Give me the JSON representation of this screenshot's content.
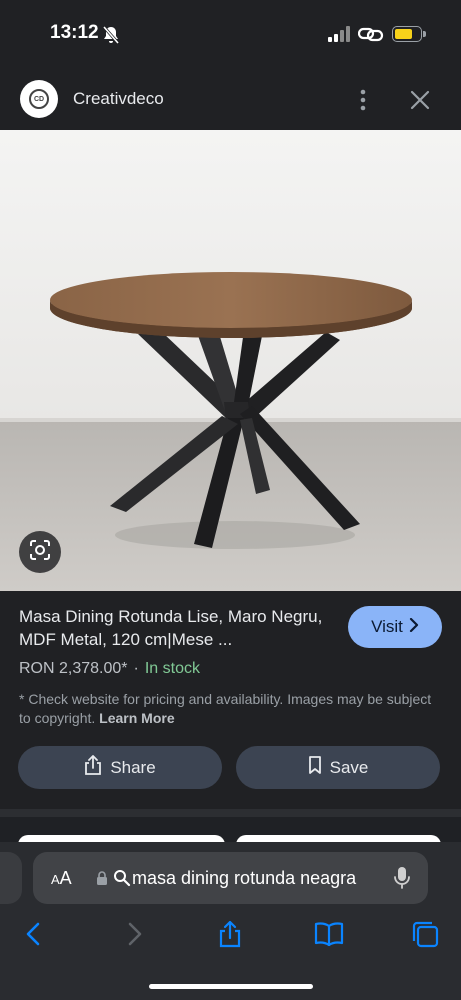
{
  "status_bar": {
    "time": "13:12",
    "icons": [
      "bell-off-icon",
      "signal-icon",
      "link-icon",
      "battery-icon"
    ],
    "battery_color": "#f7d21a"
  },
  "site": {
    "name": "Creativdeco",
    "logo_text": "CD"
  },
  "product": {
    "title": "Masa Dining Rotunda Lise, Maro Negru, MDF Metal, 120 cm|Mese ...",
    "visit_label": "Visit",
    "price": "RON 2,378.00*",
    "separator": "·",
    "stock": "In stock",
    "note": "* Check website for pricing and availability. Images may be subject to copyright.",
    "note_link": "Learn More",
    "share_label": "Share",
    "save_label": "Save"
  },
  "browser": {
    "aa_label": "AA",
    "url_text": "masa dining rotunda neagra",
    "toolbar": [
      "back-icon",
      "forward-icon",
      "share-icon",
      "bookmarks-icon",
      "tabs-icon"
    ]
  },
  "colors": {
    "accent": "#8ab4f8",
    "stock_green": "#81c995",
    "button_bg": "#3c4452",
    "ios_blue": "#0a84ff"
  }
}
